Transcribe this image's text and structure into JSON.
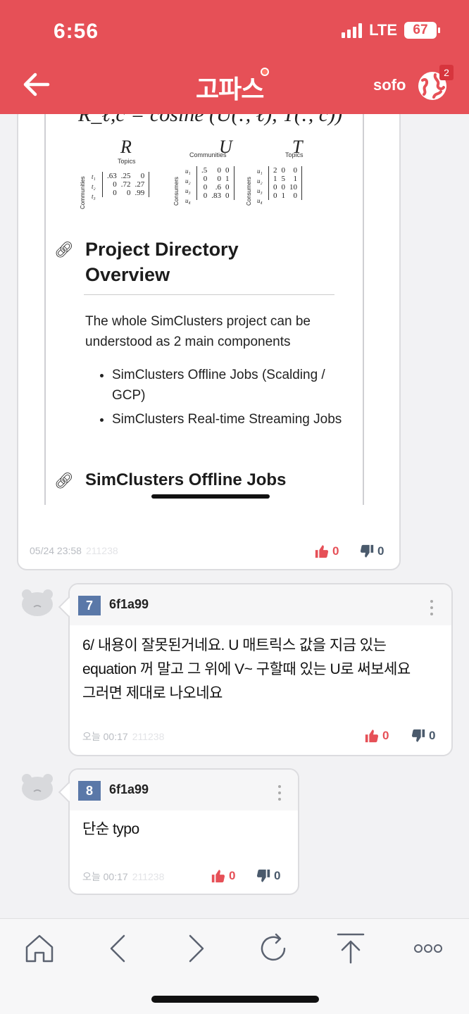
{
  "status": {
    "time": "6:56",
    "network": "LTE",
    "battery": "67"
  },
  "header": {
    "logo": "고파스",
    "user": "sofo",
    "badge": "2"
  },
  "post": {
    "formula": "R_ℓ,c = cosine (U(:, ℓ), T(:, c))",
    "matrices": [
      {
        "title": "R",
        "sub": "Topics",
        "side": "Communities",
        "rows": [
          "t₁",
          "t₂",
          "t₃"
        ],
        "values": [
          [
            ".63",
            ".25",
            "0"
          ],
          [
            "0",
            ".72",
            ".27"
          ],
          [
            "0",
            "0",
            ".99"
          ]
        ]
      },
      {
        "title": "U",
        "sub": "Communities",
        "side": "Consumers",
        "rows": [
          "u₁",
          "u₂",
          "u₃",
          "u₄"
        ],
        "values": [
          [
            ".5",
            "0",
            "0"
          ],
          [
            "0",
            "0",
            "1"
          ],
          [
            "0",
            ".6",
            "0"
          ],
          [
            "0",
            ".83",
            "0"
          ]
        ]
      },
      {
        "title": "T",
        "sub": "Topics",
        "side": "Consumers",
        "rows": [
          "u₁",
          "u₂",
          "u₃",
          "u₄"
        ],
        "values": [
          [
            "2",
            "0",
            "0"
          ],
          [
            "1",
            "5",
            "1"
          ],
          [
            "0",
            "0",
            "10"
          ],
          [
            "0",
            "1",
            "0"
          ]
        ]
      }
    ],
    "h2": "Project Directory Overview",
    "paragraph": "The whole SimClusters project can be understood as 2 main components",
    "bullets": [
      "SimClusters Offline Jobs (Scalding / GCP)",
      "SimClusters Real-time Streaming Jobs"
    ],
    "h3": "SimClusters Offline Jobs",
    "date": "05/24 23:58",
    "id": "211238",
    "likes": "0",
    "dislikes": "0"
  },
  "comments": [
    {
      "num": "7",
      "author": "6f1a99",
      "lines": [
        "6/ 내용이 잘못된거네요. U 매트릭스 값을 지금 있는",
        "equation 꺼 말고 그 위에 V~ 구할때 있는 U로 써보세요",
        "그러면 제대로 나오네요"
      ],
      "date": "오늘 00:17",
      "id": "211238",
      "likes": "0",
      "dislikes": "0"
    },
    {
      "num": "8",
      "author": "6f1a99",
      "lines": [
        "단순 typo"
      ],
      "date": "오늘 00:17",
      "id": "211238",
      "likes": "0",
      "dislikes": "0"
    }
  ],
  "toolbar": [
    "home",
    "back",
    "forward",
    "reload",
    "top",
    "more"
  ],
  "colors": {
    "brand": "#e65057",
    "badge": "#d7353d",
    "comment_num": "#5a78a8",
    "downvote": "#4a5a6c"
  }
}
